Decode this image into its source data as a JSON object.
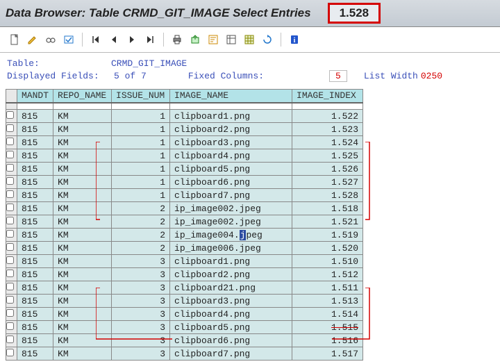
{
  "title": "Data Browser: Table CRMD_GIT_IMAGE Select Entries",
  "record_count": "1.528",
  "meta": {
    "table_label": "Table:",
    "table_name": "CRMD_GIT_IMAGE",
    "displayed_label": "Displayed Fields:",
    "displayed_val": "5 of   7",
    "fixed_label": "Fixed Columns:",
    "fixed_val": "5",
    "list_width_label": "List Width",
    "list_width_val": "0250"
  },
  "columns": [
    "MANDT",
    "REPO_NAME",
    "ISSUE_NUM",
    "IMAGE_NAME",
    "IMAGE_INDEX"
  ],
  "rows": [
    {
      "mandt": "815",
      "repo": "KM",
      "issue": "1",
      "image": "clipboard1.png",
      "idx": "1.522"
    },
    {
      "mandt": "815",
      "repo": "KM",
      "issue": "1",
      "image": "clipboard2.png",
      "idx": "1.523"
    },
    {
      "mandt": "815",
      "repo": "KM",
      "issue": "1",
      "image": "clipboard3.png",
      "idx": "1.524"
    },
    {
      "mandt": "815",
      "repo": "KM",
      "issue": "1",
      "image": "clipboard4.png",
      "idx": "1.525"
    },
    {
      "mandt": "815",
      "repo": "KM",
      "issue": "1",
      "image": "clipboard5.png",
      "idx": "1.526"
    },
    {
      "mandt": "815",
      "repo": "KM",
      "issue": "1",
      "image": "clipboard6.png",
      "idx": "1.527"
    },
    {
      "mandt": "815",
      "repo": "KM",
      "issue": "1",
      "image": "clipboard7.png",
      "idx": "1.528"
    },
    {
      "mandt": "815",
      "repo": "KM",
      "issue": "2",
      "image": "ip_image002.jpeg",
      "idx": "1.518"
    },
    {
      "mandt": "815",
      "repo": "KM",
      "issue": "2",
      "image": "ip_image002.jpeg",
      "idx": "1.521"
    },
    {
      "mandt": "815",
      "repo": "KM",
      "issue": "2",
      "image": "ip_image004.jpeg",
      "idx": "1.519",
      "hl_char": "j"
    },
    {
      "mandt": "815",
      "repo": "KM",
      "issue": "2",
      "image": "ip_image006.jpeg",
      "idx": "1.520"
    },
    {
      "mandt": "815",
      "repo": "KM",
      "issue": "3",
      "image": "clipboard1.png",
      "idx": "1.510"
    },
    {
      "mandt": "815",
      "repo": "KM",
      "issue": "3",
      "image": "clipboard2.png",
      "idx": "1.512"
    },
    {
      "mandt": "815",
      "repo": "KM",
      "issue": "3",
      "image": "clipboard21.png",
      "idx": "1.511"
    },
    {
      "mandt": "815",
      "repo": "KM",
      "issue": "3",
      "image": "clipboard3.png",
      "idx": "1.513"
    },
    {
      "mandt": "815",
      "repo": "KM",
      "issue": "3",
      "image": "clipboard4.png",
      "idx": "1.514"
    },
    {
      "mandt": "815",
      "repo": "KM",
      "issue": "3",
      "image": "clipboard5.png",
      "idx": "1.515",
      "strike": true
    },
    {
      "mandt": "815",
      "repo": "KM",
      "issue": "3",
      "image": "clipboard6.png",
      "idx": "1.516"
    },
    {
      "mandt": "815",
      "repo": "KM",
      "issue": "3",
      "image": "clipboard7.png",
      "idx": "1.517"
    }
  ],
  "toolbar": [
    {
      "name": "new-document-icon"
    },
    {
      "name": "edit-pencil-icon"
    },
    {
      "name": "glasses-icon"
    },
    {
      "name": "check-table-icon"
    },
    {
      "sep": true
    },
    {
      "name": "first-page-icon"
    },
    {
      "name": "prev-page-icon"
    },
    {
      "name": "next-page-icon"
    },
    {
      "name": "last-page-icon"
    },
    {
      "sep": true
    },
    {
      "name": "print-icon"
    },
    {
      "name": "export-icon"
    },
    {
      "name": "sort-icon"
    },
    {
      "name": "layout-icon"
    },
    {
      "name": "spreadsheet-icon"
    },
    {
      "name": "refresh-icon"
    },
    {
      "sep": true
    },
    {
      "name": "info-icon"
    }
  ]
}
